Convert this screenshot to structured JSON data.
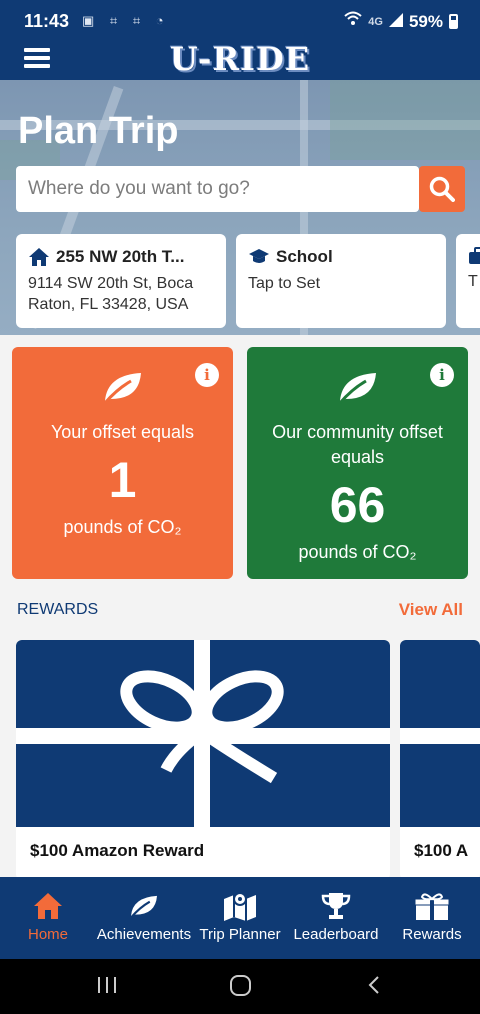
{
  "status": {
    "time": "11:43",
    "signal_label": "4G",
    "battery": "59%"
  },
  "app": {
    "logo": "U-RIDE"
  },
  "hero": {
    "title": "Plan Trip",
    "search_placeholder": "Where do you want to go?",
    "locations": [
      {
        "title": "255 NW 20th T...",
        "subtitle": "9114 SW 20th St, Boca Raton, FL 33428, USA",
        "icon": "home-icon"
      },
      {
        "title": "School",
        "subtitle": "Tap to Set",
        "icon": "graduation-cap-icon"
      },
      {
        "title": "",
        "subtitle": "T",
        "icon": "briefcase-icon"
      }
    ]
  },
  "offsets": {
    "yours": {
      "label": "Your offset equals",
      "value": "1",
      "unit": "pounds of CO₂",
      "color": "#f26b3a"
    },
    "community": {
      "label": "Our community offset equals",
      "value": "66",
      "unit": "pounds of CO₂",
      "color": "#1f7a3a"
    }
  },
  "rewards": {
    "heading": "REWARDS",
    "view_all": "View All",
    "items": [
      {
        "name": "$100 Amazon Reward"
      },
      {
        "name": "$100 A"
      }
    ]
  },
  "nav": {
    "items": [
      {
        "label": "Home",
        "icon": "home-icon",
        "active": true
      },
      {
        "label": "Achievements",
        "icon": "leaf-icon"
      },
      {
        "label": "Trip Planner",
        "icon": "map-icon"
      },
      {
        "label": "Leaderboard",
        "icon": "trophy-icon"
      },
      {
        "label": "Rewards",
        "icon": "gift-icon"
      }
    ]
  },
  "colors": {
    "primary": "#0f3a74",
    "accent": "#f26b3a",
    "green": "#1f7a3a"
  }
}
